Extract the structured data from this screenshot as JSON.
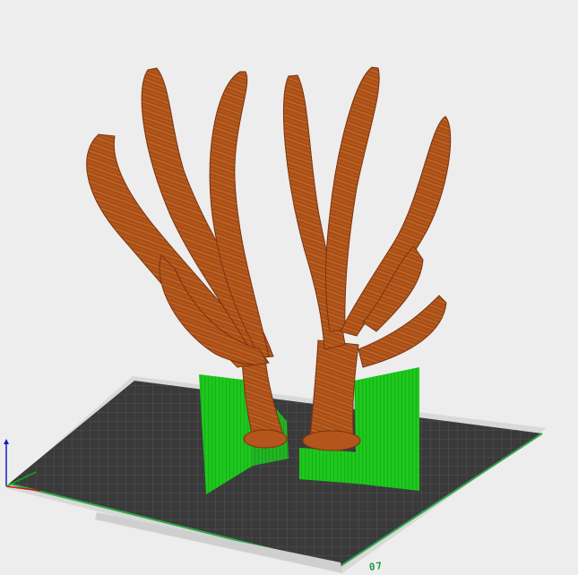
{
  "viewport": {
    "background": "#ededed",
    "bed_label": "07"
  },
  "colors": {
    "bed_plate": "#3a3a3a",
    "bed_grid": "#5c5c5c",
    "bed_edge": "#d2d2d2",
    "bed_border_green": "#2ea84a",
    "model_fill": "#b4561c",
    "model_dark": "#8a3e12",
    "model_highlight": "#d9a43a",
    "support_fill": "#1ec81e",
    "support_line": "#0f8f0f",
    "axis_x": "#d01010",
    "axis_y": "#10b010",
    "axis_z": "#1020c0"
  },
  "scene_objects": {
    "model_name": "antler-model",
    "support_name": "support-structures",
    "bed_name": "build-plate"
  }
}
